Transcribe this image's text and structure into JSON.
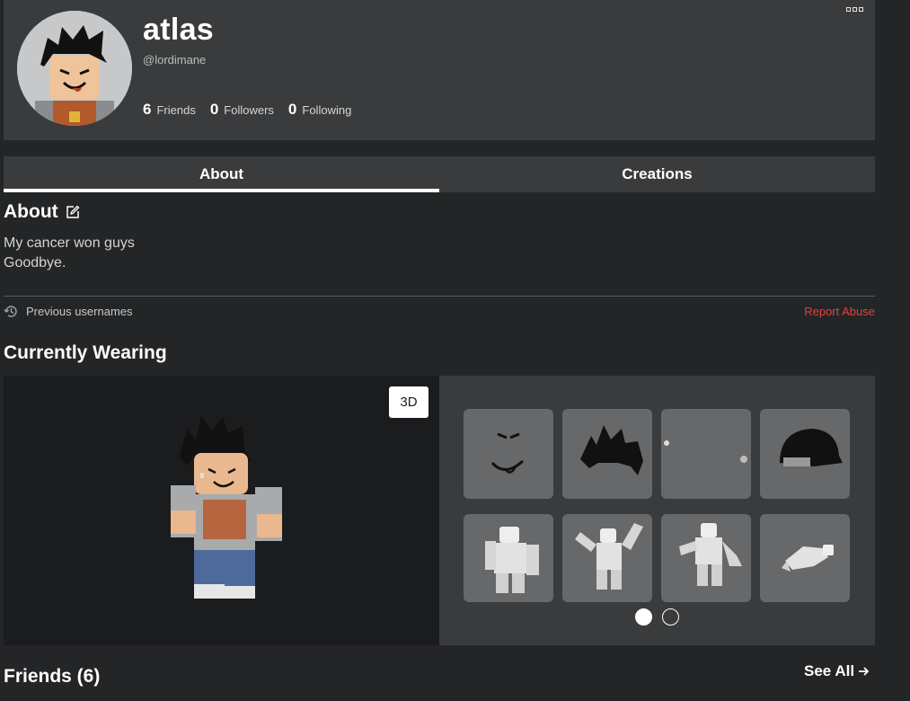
{
  "header": {
    "display_name": "atlas",
    "username": "@lordimane",
    "stats": [
      {
        "count": "6",
        "label": "Friends"
      },
      {
        "count": "0",
        "label": "Followers"
      },
      {
        "count": "0",
        "label": "Following"
      }
    ],
    "more_icon": "more-icon"
  },
  "tabs": [
    {
      "label": "About",
      "active": true
    },
    {
      "label": "Creations",
      "active": false
    }
  ],
  "about": {
    "heading": "About",
    "lines": [
      "My cancer won guys",
      "Goodbye."
    ],
    "previous_usernames": "Previous usernames",
    "report_abuse": "Report Abuse"
  },
  "wearing": {
    "title": "Currently Wearing",
    "toggle_3d": "3D",
    "items": [
      {
        "icon": "face-item"
      },
      {
        "icon": "hair-item"
      },
      {
        "icon": "earring-item"
      },
      {
        "icon": "cap-item"
      },
      {
        "icon": "animation-item"
      },
      {
        "icon": "animation-item"
      },
      {
        "icon": "animation-item"
      },
      {
        "icon": "animation-item"
      }
    ],
    "pages": 2,
    "current_page": 1
  },
  "friends": {
    "title": "Friends (6)",
    "see_all": "See All"
  },
  "colors": {
    "background": "#232527",
    "card": "#393b3d",
    "report": "#e8403a"
  }
}
